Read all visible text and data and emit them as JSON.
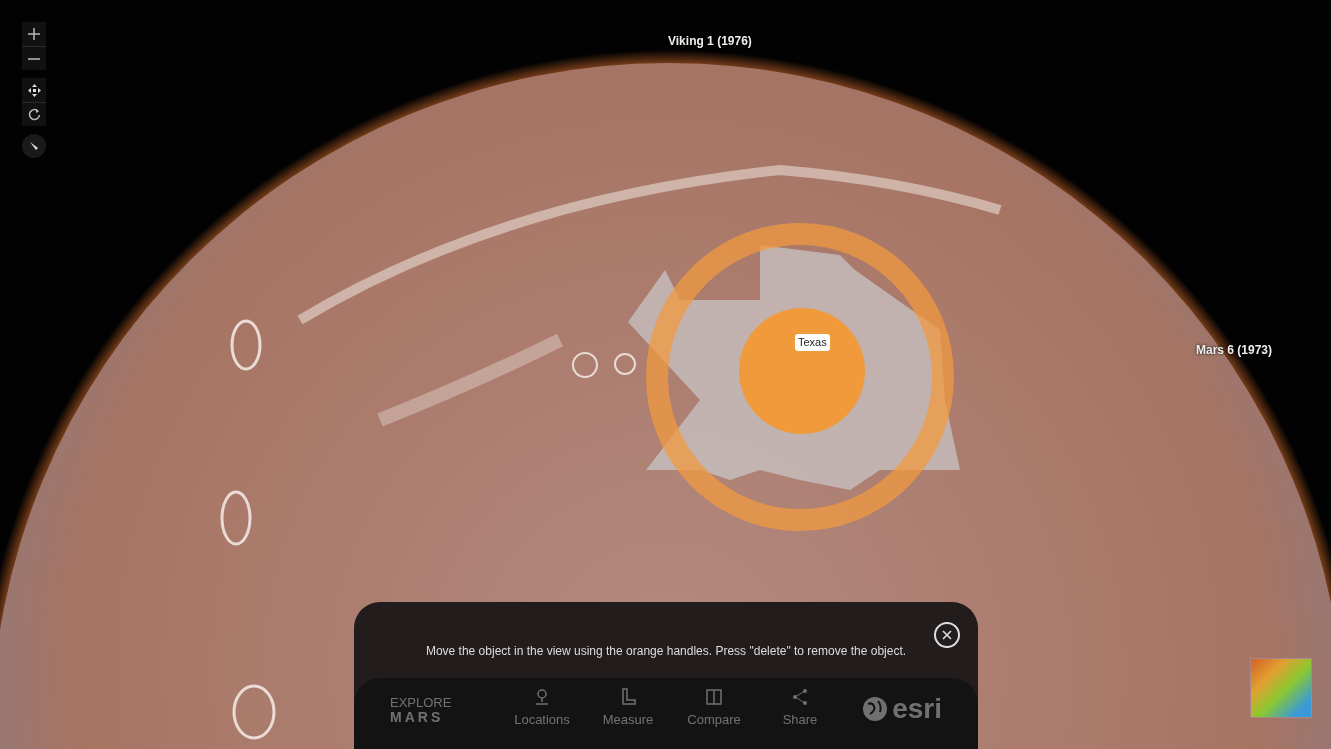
{
  "map_labels": [
    {
      "text": "Viking 1 (1976)"
    },
    {
      "text": "Mars 6 (1973)"
    }
  ],
  "object_label": "Texas",
  "message": {
    "text": "Move the object in the view using the orange handles. Press \"delete\" to remove the object."
  },
  "toolbar": {
    "dimmed": true,
    "brand_top": "EXPLORE",
    "brand_bottom": "MARS",
    "items": [
      {
        "label": "Locations"
      },
      {
        "label": "Measure"
      },
      {
        "label": "Compare"
      },
      {
        "label": "Share"
      }
    ],
    "logo": "esri"
  }
}
